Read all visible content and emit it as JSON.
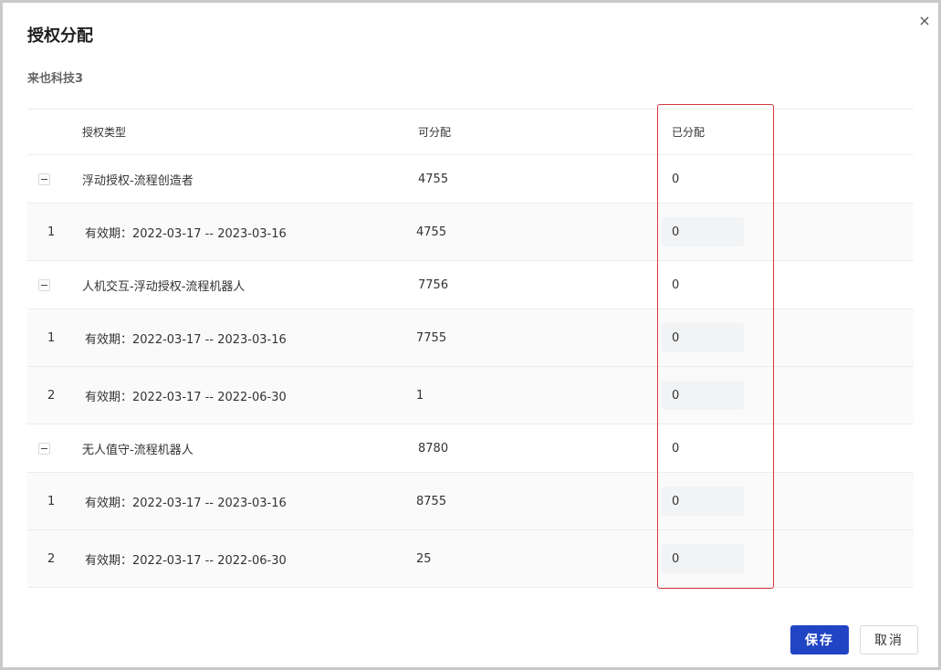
{
  "dialog": {
    "title": "授权分配",
    "company": "来也科技3",
    "close_symbol": "×",
    "save_label": "保存",
    "cancel_label": "取消"
  },
  "table": {
    "headers": {
      "type": "授权类型",
      "available": "可分配",
      "assigned": "已分配"
    },
    "groups": [
      {
        "toggle": "collapse",
        "name": "浮动授权-流程创造者",
        "available": "4755",
        "assigned": "0",
        "items": [
          {
            "index": "1",
            "period": "有效期：2022-03-17 -- 2023-03-16",
            "available": "4755",
            "assigned": "0"
          }
        ]
      },
      {
        "toggle": "collapse",
        "name": "人机交互-浮动授权-流程机器人",
        "available": "7756",
        "assigned": "0",
        "items": [
          {
            "index": "1",
            "period": "有效期：2022-03-17 -- 2023-03-16",
            "available": "7755",
            "assigned": "0"
          },
          {
            "index": "2",
            "period": "有效期：2022-03-17 -- 2022-06-30",
            "available": "1",
            "assigned": "0"
          }
        ]
      },
      {
        "toggle": "collapse",
        "name": "无人值守-流程机器人",
        "available": "8780",
        "assigned": "0",
        "items": [
          {
            "index": "1",
            "period": "有效期：2022-03-17 -- 2023-03-16",
            "available": "8755",
            "assigned": "0"
          },
          {
            "index": "2",
            "period": "有效期：2022-03-17 -- 2022-06-30",
            "available": "25",
            "assigned": "0"
          }
        ]
      }
    ]
  },
  "colors": {
    "primary": "#2144c4",
    "highlight_border": "#d9363e",
    "input_bg": "#f2f3f5"
  }
}
